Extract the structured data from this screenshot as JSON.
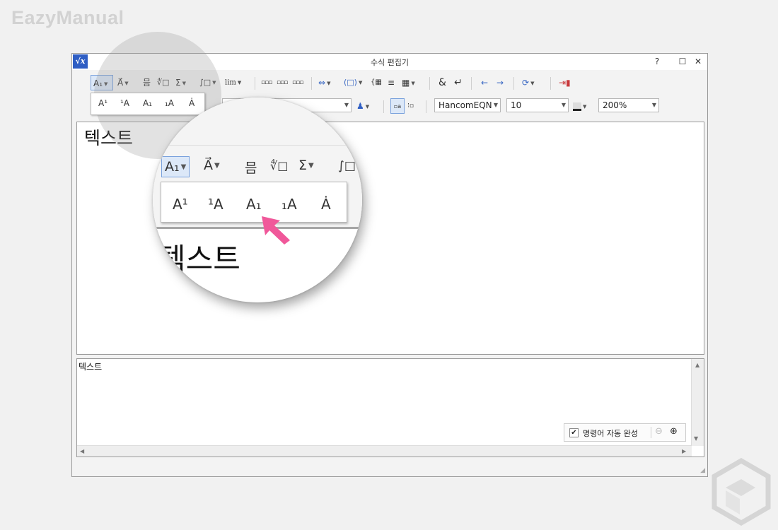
{
  "watermark": "EazyManual",
  "window": {
    "title": "수식 편집기",
    "icon_label": "√x",
    "help": "?",
    "maximize": "☐",
    "close": "✕"
  },
  "toolbar_row1": {
    "style_button": "A₁",
    "decoration_button": "A⃗",
    "fraction_button": "믐",
    "root_button": "∜□",
    "sum_button": "Σ",
    "integral_button": "∫□",
    "limit_button": "lim"
  },
  "toolbar_row2": {
    "font_name": "HancomEQN",
    "font_size": "10",
    "zoom": "200%",
    "amp": "&",
    "enter": "↵"
  },
  "style_popup": {
    "items": [
      "A¹",
      "¹A",
      "A₁",
      "₁A",
      "Ȧ"
    ]
  },
  "editor": {
    "content": "텍스트"
  },
  "script_pane": {
    "content": "텍스트",
    "autocomplete_label": "명령어 자동 완성",
    "autocomplete_checked": true
  },
  "magnifier": {
    "style_button": "A₁",
    "decoration_button": "A⃗",
    "fraction_button": "믐",
    "root_button": "∜□",
    "sum_button": "Σ",
    "integral_button": "∫□",
    "items": [
      "A¹",
      "¹A",
      "A₁",
      "₁A",
      "Ȧ"
    ],
    "editor_content": "텍스트"
  },
  "colors": {
    "accent": "#2f5ec4",
    "selection": "#dce8f8",
    "arrow": "#f0589a"
  }
}
